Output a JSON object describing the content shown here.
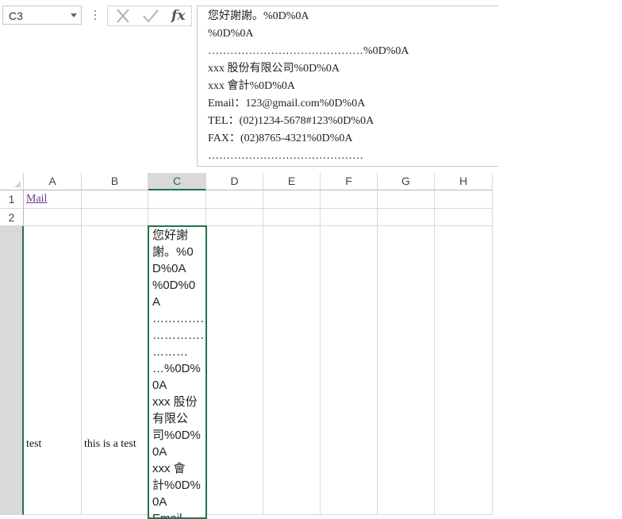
{
  "name_box": {
    "value": "C3"
  },
  "formula_bar": {
    "fx_label": "fx",
    "lines": [
      "您好謝謝。%0D%0A",
      "%0D%0A",
      "……………………………………%0D%0A",
      "xxx 股份有限公司%0D%0A",
      "xxx 會計%0D%0A",
      "Email：123@gmail.com%0D%0A",
      "TEL：(02)1234-5678#123%0D%0A",
      "FAX：(02)8765-4321%0D%0A",
      "……………………………………"
    ]
  },
  "grid": {
    "columns": [
      "A",
      "B",
      "C",
      "D",
      "E",
      "F",
      "G",
      "H"
    ],
    "rows": [
      "1",
      "2"
    ],
    "cells": {
      "A1": "Mail",
      "A3": "test",
      "B3": "this is a test"
    },
    "active_cell_lines": [
      "您好謝",
      "謝。%0",
      "D%0A",
      "%0D%0",
      "A",
      "……………",
      "……………",
      "………",
      "…%0D%",
      "0A",
      "xxx 股份",
      "有限公",
      "司%0D%",
      "0A",
      "xxx 會",
      "計%0D%",
      "0A",
      "Email"
    ]
  },
  "colors": {
    "accent": "#217346",
    "link": "#6b3a8f",
    "header_selected": "#d9d9d9"
  },
  "icons": {
    "cancel": "close-icon",
    "enter": "checkmark-icon",
    "insert_function": "fx-icon"
  }
}
